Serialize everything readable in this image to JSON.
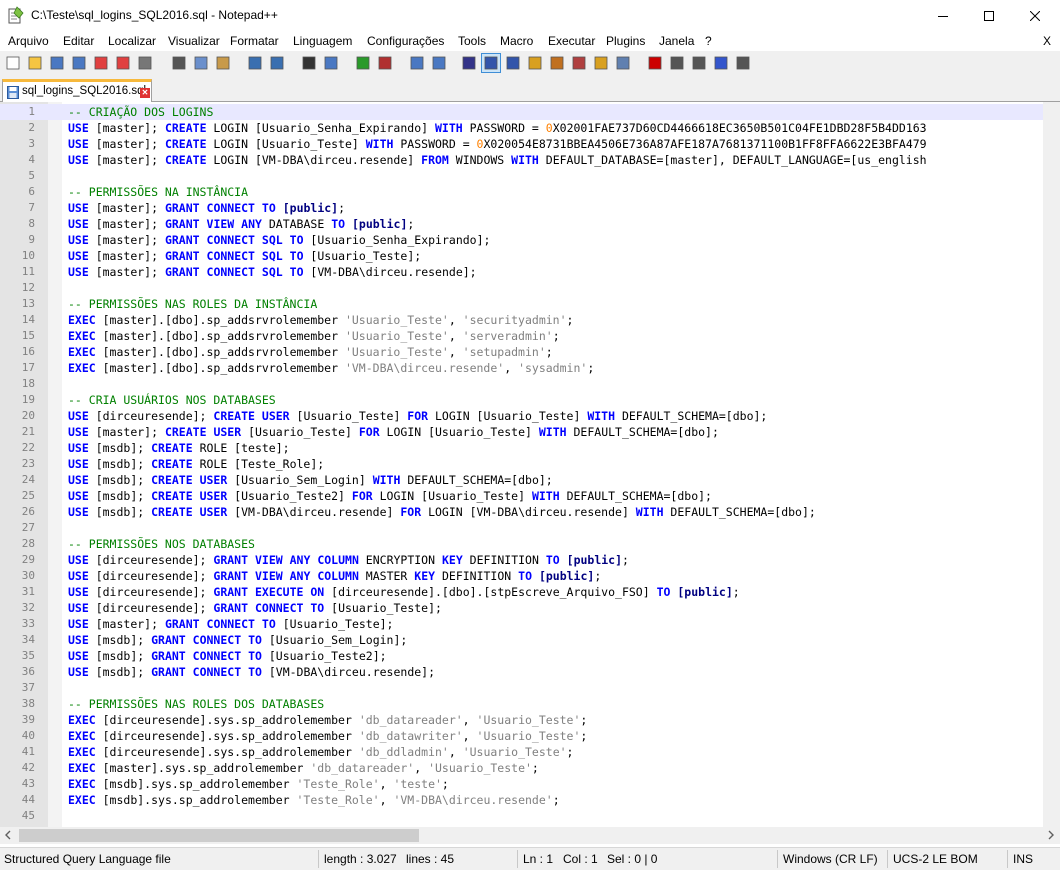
{
  "window": {
    "title": "C:\\Teste\\sql_logins_SQL2016.sql - Notepad++",
    "minimize_icon": "minimize-icon",
    "maximize_icon": "maximize-icon",
    "close_icon": "close-icon"
  },
  "menu": {
    "items": [
      "Arquivo",
      "Editar",
      "Localizar",
      "Visualizar",
      "Formatar",
      "Linguagem",
      "Configurações",
      "Tools",
      "Macro",
      "Executar",
      "Plugins",
      "Janela",
      "?"
    ],
    "close_doc": "X"
  },
  "toolbar": {
    "icons": [
      "new-file-icon",
      "open-file-icon",
      "save-icon",
      "save-all-icon",
      "close-icon",
      "close-all-icon",
      "print-icon",
      "cut-icon",
      "copy-icon",
      "paste-icon",
      "undo-icon",
      "redo-icon",
      "find-icon",
      "replace-icon",
      "zoom-in-icon",
      "zoom-out-icon",
      "sync-vertical-icon",
      "sync-horizontal-icon",
      "word-wrap-icon",
      "show-all-chars-icon",
      "indent-guide-icon",
      "doc-map-icon",
      "function-list-icon",
      "udl-icon",
      "folder-workspace-icon",
      "monitoring-icon",
      "record-macro-icon",
      "stop-macro-icon",
      "play-macro-icon",
      "run-macro-multiple-icon",
      "save-macro-icon"
    ]
  },
  "tab": {
    "label": "sql_logins_SQL2016.sql"
  },
  "editor": {
    "lines": [
      [
        [
          "c",
          "-- CRIAÇÃO DOS LOGINS"
        ]
      ],
      [
        [
          "k",
          "USE"
        ],
        [
          "p",
          " [master]; "
        ],
        [
          "k",
          "CREATE"
        ],
        [
          "p",
          " LOGIN [Usuario_Senha_Expirando] "
        ],
        [
          "k",
          "WITH"
        ],
        [
          "p",
          " PASSWORD = "
        ],
        [
          "n",
          "0"
        ],
        [
          "p",
          "X02001FAE737D60CD4466618EC3650B501C04FE1DBD28F5B4DD163"
        ]
      ],
      [
        [
          "k",
          "USE"
        ],
        [
          "p",
          " [master]; "
        ],
        [
          "k",
          "CREATE"
        ],
        [
          "p",
          " LOGIN [Usuario_Teste] "
        ],
        [
          "k",
          "WITH"
        ],
        [
          "p",
          " PASSWORD = "
        ],
        [
          "n",
          "0"
        ],
        [
          "p",
          "X020054E8731BBEA4506E736A87AFE187A7681371100B1FF8FFA6622E3BFA479"
        ]
      ],
      [
        [
          "k",
          "USE"
        ],
        [
          "p",
          " [master]; "
        ],
        [
          "k",
          "CREATE"
        ],
        [
          "p",
          " LOGIN [VM-DBA\\dirceu.resende] "
        ],
        [
          "k",
          "FROM"
        ],
        [
          "p",
          " WINDOWS "
        ],
        [
          "k",
          "WITH"
        ],
        [
          "p",
          " DEFAULT_DATABASE=[master], DEFAULT_LANGUAGE=[us_english"
        ]
      ],
      [],
      [
        [
          "c",
          "-- PERMISSÕES NA INSTÂNCIA"
        ]
      ],
      [
        [
          "k",
          "USE"
        ],
        [
          "p",
          " [master]; "
        ],
        [
          "k",
          "GRANT"
        ],
        [
          "p",
          " "
        ],
        [
          "k",
          "CONNECT"
        ],
        [
          "p",
          " "
        ],
        [
          "k",
          "TO"
        ],
        [
          "p",
          " "
        ],
        [
          "o",
          "[public]"
        ],
        [
          "p",
          ";"
        ]
      ],
      [
        [
          "k",
          "USE"
        ],
        [
          "p",
          " [master]; "
        ],
        [
          "k",
          "GRANT"
        ],
        [
          "p",
          " "
        ],
        [
          "k",
          "VIEW"
        ],
        [
          "p",
          " "
        ],
        [
          "k",
          "ANY"
        ],
        [
          "p",
          " DATABASE "
        ],
        [
          "k",
          "TO"
        ],
        [
          "p",
          " "
        ],
        [
          "o",
          "[public]"
        ],
        [
          "p",
          ";"
        ]
      ],
      [
        [
          "k",
          "USE"
        ],
        [
          "p",
          " [master]; "
        ],
        [
          "k",
          "GRANT"
        ],
        [
          "p",
          " "
        ],
        [
          "k",
          "CONNECT"
        ],
        [
          "p",
          " "
        ],
        [
          "k",
          "SQL"
        ],
        [
          "p",
          " "
        ],
        [
          "k",
          "TO"
        ],
        [
          "p",
          " [Usuario_Senha_Expirando];"
        ]
      ],
      [
        [
          "k",
          "USE"
        ],
        [
          "p",
          " [master]; "
        ],
        [
          "k",
          "GRANT"
        ],
        [
          "p",
          " "
        ],
        [
          "k",
          "CONNECT"
        ],
        [
          "p",
          " "
        ],
        [
          "k",
          "SQL"
        ],
        [
          "p",
          " "
        ],
        [
          "k",
          "TO"
        ],
        [
          "p",
          " [Usuario_Teste];"
        ]
      ],
      [
        [
          "k",
          "USE"
        ],
        [
          "p",
          " [master]; "
        ],
        [
          "k",
          "GRANT"
        ],
        [
          "p",
          " "
        ],
        [
          "k",
          "CONNECT"
        ],
        [
          "p",
          " "
        ],
        [
          "k",
          "SQL"
        ],
        [
          "p",
          " "
        ],
        [
          "k",
          "TO"
        ],
        [
          "p",
          " [VM-DBA\\dirceu.resende];"
        ]
      ],
      [],
      [
        [
          "c",
          "-- PERMISSÕES NAS ROLES DA INSTÂNCIA"
        ]
      ],
      [
        [
          "k",
          "EXEC"
        ],
        [
          "p",
          " [master].[dbo].sp_addsrvrolemember "
        ],
        [
          "s",
          "'Usuario_Teste'"
        ],
        [
          "p",
          ", "
        ],
        [
          "s",
          "'securityadmin'"
        ],
        [
          "p",
          ";"
        ]
      ],
      [
        [
          "k",
          "EXEC"
        ],
        [
          "p",
          " [master].[dbo].sp_addsrvrolemember "
        ],
        [
          "s",
          "'Usuario_Teste'"
        ],
        [
          "p",
          ", "
        ],
        [
          "s",
          "'serveradmin'"
        ],
        [
          "p",
          ";"
        ]
      ],
      [
        [
          "k",
          "EXEC"
        ],
        [
          "p",
          " [master].[dbo].sp_addsrvrolemember "
        ],
        [
          "s",
          "'Usuario_Teste'"
        ],
        [
          "p",
          ", "
        ],
        [
          "s",
          "'setupadmin'"
        ],
        [
          "p",
          ";"
        ]
      ],
      [
        [
          "k",
          "EXEC"
        ],
        [
          "p",
          " [master].[dbo].sp_addsrvrolemember "
        ],
        [
          "s",
          "'VM-DBA\\dirceu.resende'"
        ],
        [
          "p",
          ", "
        ],
        [
          "s",
          "'sysadmin'"
        ],
        [
          "p",
          ";"
        ]
      ],
      [],
      [
        [
          "c",
          "-- CRIA USUÁRIOS NOS DATABASES"
        ]
      ],
      [
        [
          "k",
          "USE"
        ],
        [
          "p",
          " [dirceuresende]; "
        ],
        [
          "k",
          "CREATE"
        ],
        [
          "p",
          " "
        ],
        [
          "k",
          "USER"
        ],
        [
          "p",
          " [Usuario_Teste] "
        ],
        [
          "k",
          "FOR"
        ],
        [
          "p",
          " LOGIN [Usuario_Teste] "
        ],
        [
          "k",
          "WITH"
        ],
        [
          "p",
          " DEFAULT_SCHEMA=[dbo];"
        ]
      ],
      [
        [
          "k",
          "USE"
        ],
        [
          "p",
          " [master]; "
        ],
        [
          "k",
          "CREATE"
        ],
        [
          "p",
          " "
        ],
        [
          "k",
          "USER"
        ],
        [
          "p",
          " [Usuario_Teste] "
        ],
        [
          "k",
          "FOR"
        ],
        [
          "p",
          " LOGIN [Usuario_Teste] "
        ],
        [
          "k",
          "WITH"
        ],
        [
          "p",
          " DEFAULT_SCHEMA=[dbo];"
        ]
      ],
      [
        [
          "k",
          "USE"
        ],
        [
          "p",
          " [msdb]; "
        ],
        [
          "k",
          "CREATE"
        ],
        [
          "p",
          " ROLE [teste];"
        ]
      ],
      [
        [
          "k",
          "USE"
        ],
        [
          "p",
          " [msdb]; "
        ],
        [
          "k",
          "CREATE"
        ],
        [
          "p",
          " ROLE [Teste_Role];"
        ]
      ],
      [
        [
          "k",
          "USE"
        ],
        [
          "p",
          " [msdb]; "
        ],
        [
          "k",
          "CREATE"
        ],
        [
          "p",
          " "
        ],
        [
          "k",
          "USER"
        ],
        [
          "p",
          " [Usuario_Sem_Login] "
        ],
        [
          "k",
          "WITH"
        ],
        [
          "p",
          " DEFAULT_SCHEMA=[dbo];"
        ]
      ],
      [
        [
          "k",
          "USE"
        ],
        [
          "p",
          " [msdb]; "
        ],
        [
          "k",
          "CREATE"
        ],
        [
          "p",
          " "
        ],
        [
          "k",
          "USER"
        ],
        [
          "p",
          " [Usuario_Teste2] "
        ],
        [
          "k",
          "FOR"
        ],
        [
          "p",
          " LOGIN [Usuario_Teste] "
        ],
        [
          "k",
          "WITH"
        ],
        [
          "p",
          " DEFAULT_SCHEMA=[dbo];"
        ]
      ],
      [
        [
          "k",
          "USE"
        ],
        [
          "p",
          " [msdb]; "
        ],
        [
          "k",
          "CREATE"
        ],
        [
          "p",
          " "
        ],
        [
          "k",
          "USER"
        ],
        [
          "p",
          " [VM-DBA\\dirceu.resende] "
        ],
        [
          "k",
          "FOR"
        ],
        [
          "p",
          " LOGIN [VM-DBA\\dirceu.resende] "
        ],
        [
          "k",
          "WITH"
        ],
        [
          "p",
          " DEFAULT_SCHEMA=[dbo];"
        ]
      ],
      [],
      [
        [
          "c",
          "-- PERMISSÕES NOS DATABASES"
        ]
      ],
      [
        [
          "k",
          "USE"
        ],
        [
          "p",
          " [dirceuresende]; "
        ],
        [
          "k",
          "GRANT"
        ],
        [
          "p",
          " "
        ],
        [
          "k",
          "VIEW"
        ],
        [
          "p",
          " "
        ],
        [
          "k",
          "ANY"
        ],
        [
          "p",
          " "
        ],
        [
          "k",
          "COLUMN"
        ],
        [
          "p",
          " ENCRYPTION "
        ],
        [
          "k",
          "KEY"
        ],
        [
          "p",
          " DEFINITION "
        ],
        [
          "k",
          "TO"
        ],
        [
          "p",
          " "
        ],
        [
          "o",
          "[public]"
        ],
        [
          "p",
          ";"
        ]
      ],
      [
        [
          "k",
          "USE"
        ],
        [
          "p",
          " [dirceuresende]; "
        ],
        [
          "k",
          "GRANT"
        ],
        [
          "p",
          " "
        ],
        [
          "k",
          "VIEW"
        ],
        [
          "p",
          " "
        ],
        [
          "k",
          "ANY"
        ],
        [
          "p",
          " "
        ],
        [
          "k",
          "COLUMN"
        ],
        [
          "p",
          " MASTER "
        ],
        [
          "k",
          "KEY"
        ],
        [
          "p",
          " DEFINITION "
        ],
        [
          "k",
          "TO"
        ],
        [
          "p",
          " "
        ],
        [
          "o",
          "[public]"
        ],
        [
          "p",
          ";"
        ]
      ],
      [
        [
          "k",
          "USE"
        ],
        [
          "p",
          " [dirceuresende]; "
        ],
        [
          "k",
          "GRANT"
        ],
        [
          "p",
          " "
        ],
        [
          "k",
          "EXECUTE"
        ],
        [
          "p",
          " "
        ],
        [
          "k",
          "ON"
        ],
        [
          "p",
          " [dirceuresende].[dbo].[stpEscreve_Arquivo_FSO] "
        ],
        [
          "k",
          "TO"
        ],
        [
          "p",
          " "
        ],
        [
          "o",
          "[public]"
        ],
        [
          "p",
          ";"
        ]
      ],
      [
        [
          "k",
          "USE"
        ],
        [
          "p",
          " [dirceuresende]; "
        ],
        [
          "k",
          "GRANT"
        ],
        [
          "p",
          " "
        ],
        [
          "k",
          "CONNECT"
        ],
        [
          "p",
          " "
        ],
        [
          "k",
          "TO"
        ],
        [
          "p",
          " [Usuario_Teste];"
        ]
      ],
      [
        [
          "k",
          "USE"
        ],
        [
          "p",
          " [master]; "
        ],
        [
          "k",
          "GRANT"
        ],
        [
          "p",
          " "
        ],
        [
          "k",
          "CONNECT"
        ],
        [
          "p",
          " "
        ],
        [
          "k",
          "TO"
        ],
        [
          "p",
          " [Usuario_Teste];"
        ]
      ],
      [
        [
          "k",
          "USE"
        ],
        [
          "p",
          " [msdb]; "
        ],
        [
          "k",
          "GRANT"
        ],
        [
          "p",
          " "
        ],
        [
          "k",
          "CONNECT"
        ],
        [
          "p",
          " "
        ],
        [
          "k",
          "TO"
        ],
        [
          "p",
          " [Usuario_Sem_Login];"
        ]
      ],
      [
        [
          "k",
          "USE"
        ],
        [
          "p",
          " [msdb]; "
        ],
        [
          "k",
          "GRANT"
        ],
        [
          "p",
          " "
        ],
        [
          "k",
          "CONNECT"
        ],
        [
          "p",
          " "
        ],
        [
          "k",
          "TO"
        ],
        [
          "p",
          " [Usuario_Teste2];"
        ]
      ],
      [
        [
          "k",
          "USE"
        ],
        [
          "p",
          " [msdb]; "
        ],
        [
          "k",
          "GRANT"
        ],
        [
          "p",
          " "
        ],
        [
          "k",
          "CONNECT"
        ],
        [
          "p",
          " "
        ],
        [
          "k",
          "TO"
        ],
        [
          "p",
          " [VM-DBA\\dirceu.resende];"
        ]
      ],
      [],
      [
        [
          "c",
          "-- PERMISSÕES NAS ROLES DOS DATABASES"
        ]
      ],
      [
        [
          "k",
          "EXEC"
        ],
        [
          "p",
          " [dirceuresende].sys.sp_addrolemember "
        ],
        [
          "s",
          "'db_datareader'"
        ],
        [
          "p",
          ", "
        ],
        [
          "s",
          "'Usuario_Teste'"
        ],
        [
          "p",
          ";"
        ]
      ],
      [
        [
          "k",
          "EXEC"
        ],
        [
          "p",
          " [dirceuresende].sys.sp_addrolemember "
        ],
        [
          "s",
          "'db_datawriter'"
        ],
        [
          "p",
          ", "
        ],
        [
          "s",
          "'Usuario_Teste'"
        ],
        [
          "p",
          ";"
        ]
      ],
      [
        [
          "k",
          "EXEC"
        ],
        [
          "p",
          " [dirceuresende].sys.sp_addrolemember "
        ],
        [
          "s",
          "'db_ddladmin'"
        ],
        [
          "p",
          ", "
        ],
        [
          "s",
          "'Usuario_Teste'"
        ],
        [
          "p",
          ";"
        ]
      ],
      [
        [
          "k",
          "EXEC"
        ],
        [
          "p",
          " [master].sys.sp_addrolemember "
        ],
        [
          "s",
          "'db_datareader'"
        ],
        [
          "p",
          ", "
        ],
        [
          "s",
          "'Usuario_Teste'"
        ],
        [
          "p",
          ";"
        ]
      ],
      [
        [
          "k",
          "EXEC"
        ],
        [
          "p",
          " [msdb].sys.sp_addrolemember "
        ],
        [
          "s",
          "'Teste_Role'"
        ],
        [
          "p",
          ", "
        ],
        [
          "s",
          "'teste'"
        ],
        [
          "p",
          ";"
        ]
      ],
      [
        [
          "k",
          "EXEC"
        ],
        [
          "p",
          " [msdb].sys.sp_addrolemember "
        ],
        [
          "s",
          "'Teste_Role'"
        ],
        [
          "p",
          ", "
        ],
        [
          "s",
          "'VM-DBA\\dirceu.resende'"
        ],
        [
          "p",
          ";"
        ]
      ],
      []
    ],
    "current_line": 1
  },
  "status": {
    "file_type": "Structured Query Language file",
    "length": "length : 3.027",
    "lines": "lines : 45",
    "ln": "Ln : 1",
    "col": "Col : 1",
    "sel": "Sel : 0 | 0",
    "eol": "Windows (CR LF)",
    "encoding": "UCS-2 LE BOM",
    "mode": "INS"
  }
}
